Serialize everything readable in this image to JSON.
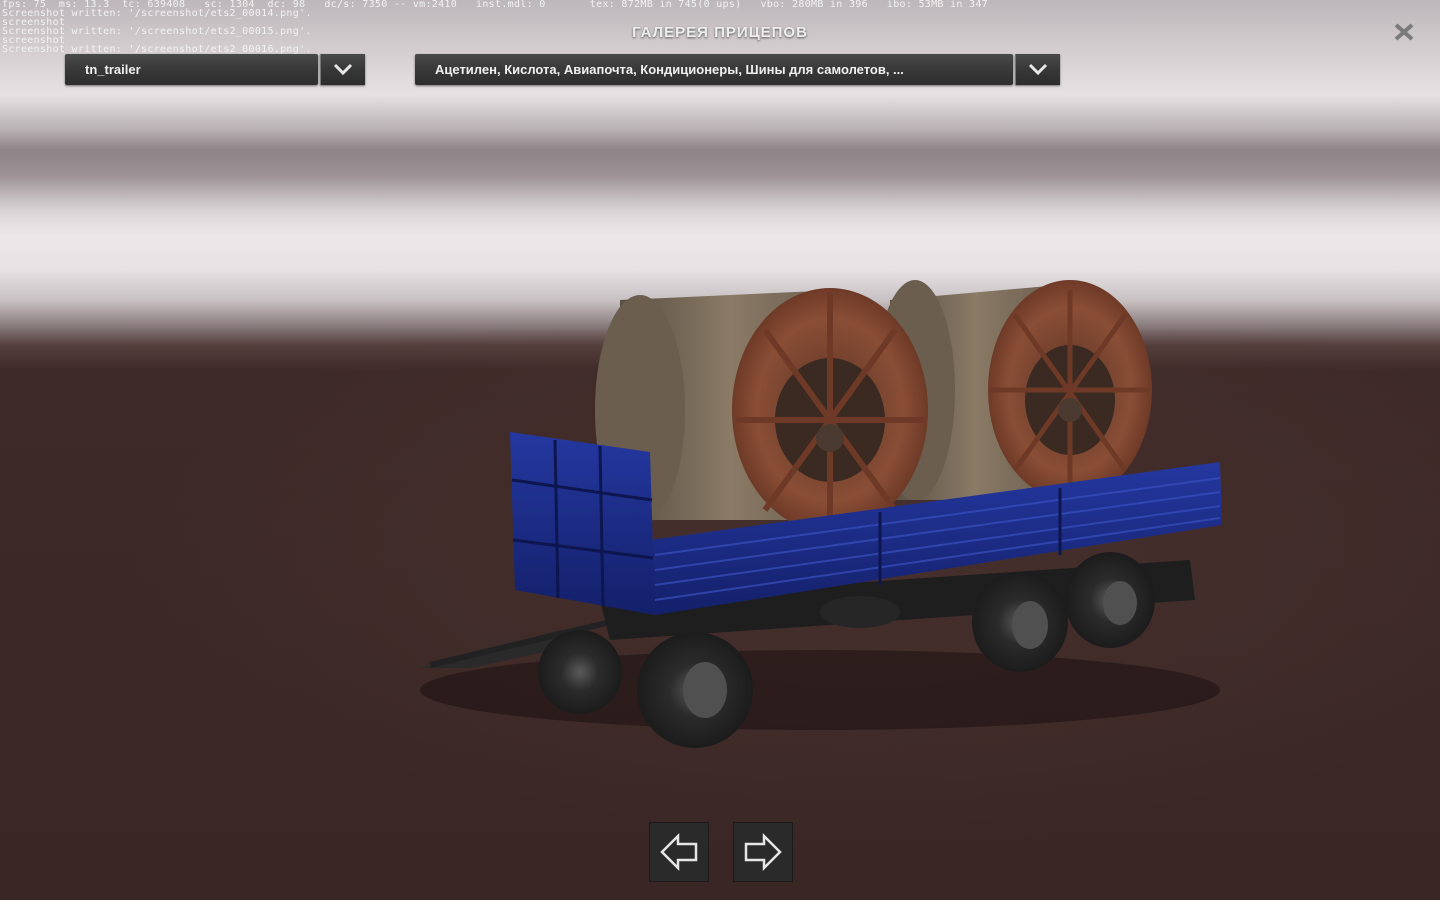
{
  "debug": {
    "stats": "fps: 75  ms: 13.3  tc: 639408   sc: 1304  dc: 98   dc/s: 7350 -- vm:2410   inst.mdl: 0       tex: 872MB in 745(0 ups)   vbo: 280MB in 396   ibo: 53MB in 347",
    "line2": "Screenshot written: '/screenshot/ets2_00014.png'.",
    "line3": "screenshot",
    "line4": "Screenshot written: '/screenshot/ets2_00015.png'.",
    "line5": "screenshot",
    "line6": "Screenshot written: '/screenshot/ets2_00016.png'."
  },
  "window": {
    "title": "ГАЛЕРЕЯ ПРИЦЕПОВ",
    "close_icon": "close-icon"
  },
  "trailer_select": {
    "value": "tn_trailer",
    "icon": "chevron-down-icon"
  },
  "cargo_select": {
    "value": "Ацетилен, Кислота, Авиапочта, Кондиционеры, Шины для самолетов, ...",
    "icon": "chevron-down-icon"
  },
  "nav": {
    "prev_icon": "arrow-left-icon",
    "next_icon": "arrow-right-icon"
  },
  "colors": {
    "trailer_body": "#1a2a8a",
    "spool_wood": "#7a6a55",
    "spool_flange": "#8a4a32",
    "floor": "#3a2725"
  }
}
